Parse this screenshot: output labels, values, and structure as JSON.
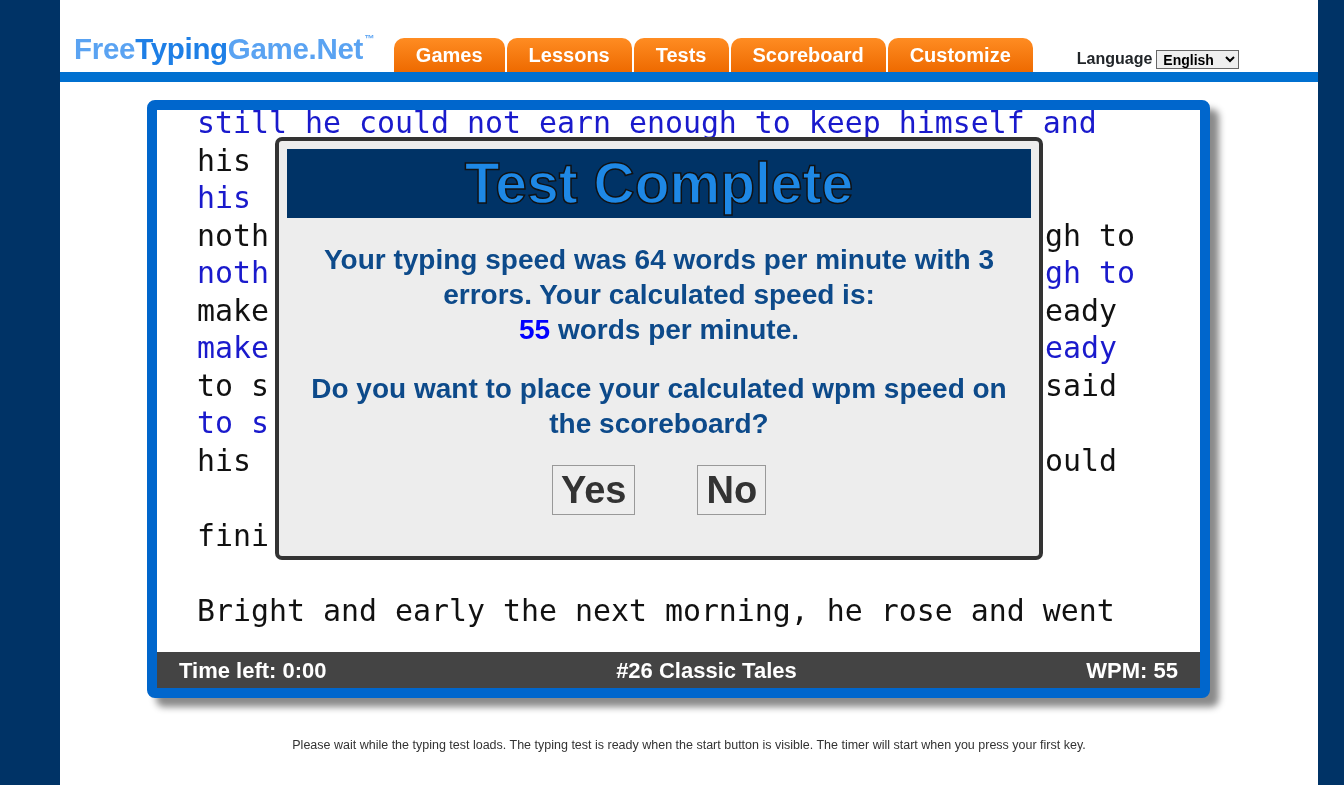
{
  "logo": {
    "parts": [
      {
        "text": "Free",
        "color": "#5aa3f2"
      },
      {
        "text": "Typing",
        "color": "#1e7fe6"
      },
      {
        "text": "Game.Net",
        "color": "#5aa3f2"
      }
    ],
    "trademark": "™"
  },
  "nav_tabs": [
    {
      "label": "Games"
    },
    {
      "label": "Lessons"
    },
    {
      "label": "Tests"
    },
    {
      "label": "Scoreboard"
    },
    {
      "label": "Customize"
    }
  ],
  "language": {
    "label": "Language",
    "value": "English"
  },
  "passage": {
    "lines": [
      {
        "kind": "typed",
        "left": "still he could not earn enough to keep himself and"
      },
      {
        "kind": "source",
        "left": "his"
      },
      {
        "kind": "typed",
        "left": "his"
      },
      {
        "kind": "source",
        "left": "noth",
        "right": "gh to"
      },
      {
        "kind": "typed",
        "left": "noth",
        "right": "gh to"
      },
      {
        "kind": "source",
        "left": "make",
        "right": "eady"
      },
      {
        "kind": "typed",
        "left": "make",
        "right": "eady"
      },
      {
        "kind": "source",
        "left": "to s",
        "right": "said"
      },
      {
        "kind": "typed",
        "left": "to s"
      },
      {
        "kind": "source",
        "left": "his",
        "right": "ould"
      },
      {
        "kind": "blank"
      },
      {
        "kind": "source",
        "left": "fini"
      },
      {
        "kind": "blank"
      },
      {
        "kind": "source",
        "left": "Bright and early the next morning, he rose and went"
      }
    ]
  },
  "status_bar": {
    "time_left": "Time left: 0:00",
    "test_name": "#26 Classic Tales",
    "wpm": "WPM: 55"
  },
  "dialog": {
    "title": "Test Complete",
    "message": "Your typing speed was 64 words per minute with 3 errors. Your calculated speed is:",
    "score": "55",
    "score_unit": "words per minute.",
    "question": "Do you want to place your calculated wpm speed on the scoreboard?",
    "buttons": [
      "Yes",
      "No"
    ]
  },
  "footer_note": "Please wait while the typing test loads. The typing test is ready when the start button is visible. The timer will start when you press your first key."
}
